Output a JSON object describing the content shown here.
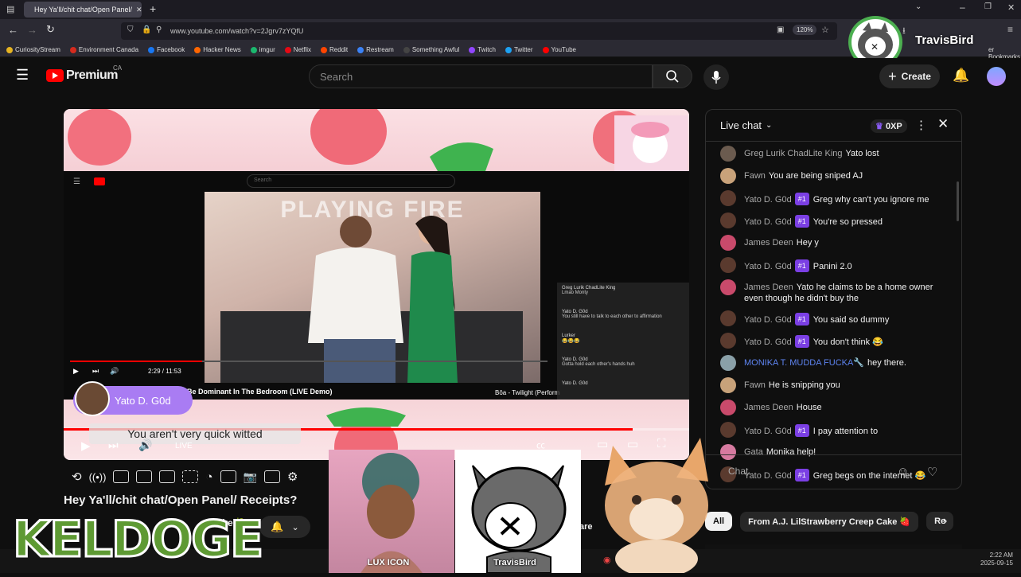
{
  "browser": {
    "tab_title": "Hey Ya'll/chit chat/Open Panel/",
    "url": "www.youtube.com/watch?v=2Jgrv7zYQfU",
    "zoom": "120%",
    "bookmarks": [
      {
        "label": "CuriosityStream",
        "color": "#e6b422"
      },
      {
        "label": "Environment Canada",
        "color": "#d52b1e"
      },
      {
        "label": "Facebook",
        "color": "#1877f2"
      },
      {
        "label": "Hacker News",
        "color": "#ff6600"
      },
      {
        "label": "imgur",
        "color": "#1bb76e"
      },
      {
        "label": "Netflix",
        "color": "#e50914"
      },
      {
        "label": "Reddit",
        "color": "#ff4500"
      },
      {
        "label": "Restream",
        "color": "#3b82f6"
      },
      {
        "label": "Something Awful",
        "color": "#444444"
      },
      {
        "label": "Twitch",
        "color": "#9146ff"
      },
      {
        "label": "Twitter",
        "color": "#1da1f2"
      },
      {
        "label": "YouTube",
        "color": "#ff0000"
      }
    ],
    "other_bookmarks": "er Bookmarks"
  },
  "overlay_name": "TravisBird",
  "youtube": {
    "logo": "Premium",
    "region": "CA",
    "search_placeholder": "Search",
    "create_label": "Create"
  },
  "video": {
    "inner_time": "2:29 / 11:53",
    "inner_banner": "PLAYING FIRE",
    "inner_search": "Search",
    "inner_title": "Be Dominant In The Bedroom (LIVE Demo)",
    "inner_side_title": "Bôa - Twilight (Perform",
    "inner_chat": [
      {
        "author": "Greg Lurik ChadLite King",
        "text": "Lmao Monty"
      },
      {
        "author": "Yato D. G0d",
        "text": "You still have to talk to each other to affirmation"
      },
      {
        "author": "Lurker",
        "text": "😂😂😂"
      },
      {
        "author": "Yato D. G0d",
        "text": "Gotta hold each other's hands huh"
      },
      {
        "author": "Yato D. G0d",
        "text": ""
      }
    ],
    "highlight_name": "Yato D. G0d",
    "caption": "You aren't very quick witted",
    "live_label": "LIVE",
    "title": "Hey Ya'll/chit chat/Open Panel/ Receipts?",
    "related_snippet": "Cake 🍓",
    "share_snippet": "are"
  },
  "chat": {
    "header": "Live chat",
    "xp": "0XP",
    "input_placeholder": "Chat...",
    "messages": [
      {
        "author": "Greg Lurik ChadLite King",
        "badge": "",
        "text": "Yato lost",
        "color": "#6b5b4f",
        "author_color": "#aaaaaa"
      },
      {
        "author": "Fawn",
        "badge": "",
        "text": "You are being sniped AJ",
        "color": "#c8a27a",
        "author_color": "#aaaaaa"
      },
      {
        "author": "Yato D. G0d",
        "badge": "#1",
        "text": "Greg why can't you ignore me",
        "color": "#5a3a2e",
        "author_color": "#aaaaaa"
      },
      {
        "author": "Yato D. G0d",
        "badge": "#1",
        "text": "You're so pressed",
        "color": "#5a3a2e",
        "author_color": "#aaaaaa"
      },
      {
        "author": "James Deen",
        "badge": "",
        "text": "Hey y",
        "color": "#c94a6b",
        "author_color": "#aaaaaa"
      },
      {
        "author": "Yato D. G0d",
        "badge": "#1",
        "text": "Panini 2.0",
        "color": "#5a3a2e",
        "author_color": "#aaaaaa"
      },
      {
        "author": "James Deen",
        "badge": "",
        "text": "Yato he claims to be a home owner even though he didn't buy the",
        "color": "#c94a6b",
        "author_color": "#aaaaaa"
      },
      {
        "author": "Yato D. G0d",
        "badge": "#1",
        "text": "You said so dummy",
        "color": "#5a3a2e",
        "author_color": "#aaaaaa"
      },
      {
        "author": "Yato D. G0d",
        "badge": "#1",
        "text": "You don't think 😂",
        "color": "#5a3a2e",
        "author_color": "#aaaaaa"
      },
      {
        "author": "MONIKA T. MUDDA FUCKA🔧",
        "badge": "",
        "text": "hey there.",
        "color": "#8aa0a8",
        "author_color": "#5e84f1"
      },
      {
        "author": "Fawn",
        "badge": "",
        "text": "He is snipping you",
        "color": "#c8a27a",
        "author_color": "#aaaaaa"
      },
      {
        "author": "James Deen",
        "badge": "",
        "text": "House",
        "color": "#c94a6b",
        "author_color": "#aaaaaa"
      },
      {
        "author": "Yato D. G0d",
        "badge": "#1",
        "text": "I pay attention to",
        "color": "#5a3a2e",
        "author_color": "#aaaaaa"
      },
      {
        "author": "Gata",
        "badge": "",
        "text": "Monika help!",
        "color": "#d67aa0",
        "author_color": "#aaaaaa"
      },
      {
        "author": "Yato D. G0d",
        "badge": "#1",
        "text": "Greg begs on the internet 😂",
        "color": "#5a3a2e",
        "author_color": "#aaaaaa"
      }
    ]
  },
  "chips": [
    "All",
    "From A.J. LilStrawberry Creep Cake 🍓",
    "Re"
  ],
  "stream_overlay": {
    "keldoge": "KELDOGE",
    "lux_label": "LUX ICON",
    "travis_label": "TravisBird"
  },
  "clock": {
    "time": "2:22 AM",
    "date": "2025-09-15"
  }
}
